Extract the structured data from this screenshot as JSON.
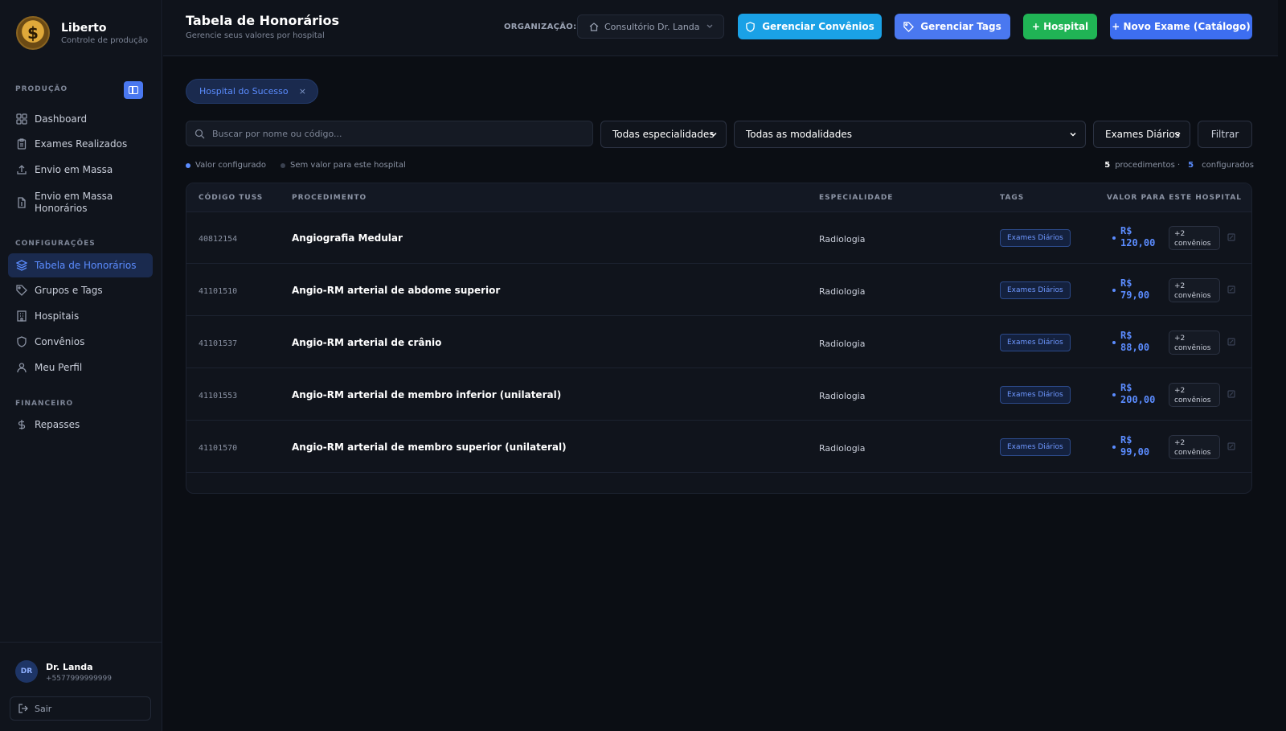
{
  "brand": {
    "name": "Liberto",
    "subtitle": "Controle de produção",
    "logo_symbol": "$"
  },
  "sidebar": {
    "section_producao": "PRODUÇÃO",
    "section_config": "CONFIGURAÇÕES",
    "section_financeiro": "FINANCEIRO",
    "items": [
      {
        "label": "Dashboard",
        "icon": "grid-icon"
      },
      {
        "label": "Exames Realizados",
        "icon": "clipboard-icon"
      },
      {
        "label": "Envio em Massa",
        "icon": "upload-icon"
      },
      {
        "label": "Envio em Massa Honorários",
        "icon": "file-dollar-icon"
      },
      {
        "label": "Tabela de Honorários",
        "icon": "layers-icon",
        "active": true
      },
      {
        "label": "Grupos e Tags",
        "icon": "tag-icon"
      },
      {
        "label": "Hospitais",
        "icon": "building-icon"
      },
      {
        "label": "Convênios",
        "icon": "shield-icon"
      },
      {
        "label": "Meu Perfil",
        "icon": "user-icon"
      },
      {
        "label": "Repasses",
        "icon": "dollar-icon"
      }
    ],
    "user": {
      "initials": "DR",
      "name": "Dr. Landa",
      "phone": "+5577999999999"
    },
    "logout_label": "Sair"
  },
  "header": {
    "title": "Tabela de Honorários",
    "subtitle": "Gerencie seus valores por hospital",
    "org_label": "ORGANIZAÇÃO:",
    "org_value": "Consultório Dr. Landa",
    "btn_convenios": "Gerenciar Convênios",
    "btn_tags": "Gerenciar Tags",
    "btn_hospital": "+ Hospital",
    "btn_exame": "+ Novo Exame (Catálogo)"
  },
  "filters": {
    "hospital_chip": "Hospital do Sucesso",
    "chip_close": "×",
    "search_placeholder": "Buscar por nome ou código...",
    "especialidade": "Todas especialidades",
    "modalidade": "Todas as modalidades",
    "tag": "Exames Diários",
    "filter_button": "Filtrar"
  },
  "legend": {
    "configured": "Valor configurado",
    "not_configured": "Sem valor para este hospital",
    "configured_color": "#5b8cff",
    "not_configured_color": "#3a4150"
  },
  "counts": {
    "procedimentos_num": "5",
    "procedimentos_label": "procedimentos ·",
    "configurados_num": "5",
    "configurados_label": "configurados"
  },
  "table": {
    "headers": [
      "CÓDIGO TUSS",
      "PROCEDIMENTO",
      "ESPECIALIDADE",
      "TAGS",
      "VALOR PARA ESTE HOSPITAL"
    ],
    "rows": [
      {
        "code": "40812154",
        "procedure": "Angiografia Medular",
        "specialty": "Radiologia",
        "tag": "Exames Diários",
        "value_currency": "R$",
        "value_amount": "120,00",
        "convenios_count": "+2",
        "convenios_label": "convênios"
      },
      {
        "code": "41101510",
        "procedure": "Angio-RM arterial de abdome superior",
        "specialty": "Radiologia",
        "tag": "Exames Diários",
        "value_currency": "R$",
        "value_amount": "79,00",
        "convenios_count": "+2",
        "convenios_label": "convênios"
      },
      {
        "code": "41101537",
        "procedure": "Angio-RM arterial de crânio",
        "specialty": "Radiologia",
        "tag": "Exames Diários",
        "value_currency": "R$",
        "value_amount": "88,00",
        "convenios_count": "+2",
        "convenios_label": "convênios"
      },
      {
        "code": "41101553",
        "procedure": "Angio-RM arterial de membro inferior (unilateral)",
        "specialty": "Radiologia",
        "tag": "Exames Diários",
        "value_currency": "R$",
        "value_amount": "200,00",
        "convenios_count": "+2",
        "convenios_label": "convênios"
      },
      {
        "code": "41101570",
        "procedure": "Angio-RM arterial de membro superior (unilateral)",
        "specialty": "Radiologia",
        "tag": "Exames Diários",
        "value_currency": "R$",
        "value_amount": "99,00",
        "convenios_count": "+2",
        "convenios_label": "convênios"
      }
    ]
  },
  "colors": {
    "accent": "#5b8cff",
    "btn_convenios": "#1aa1e6",
    "btn_tags": "#4a78f0",
    "btn_hospital": "#20b455",
    "btn_exame": "#3d6ef0"
  }
}
